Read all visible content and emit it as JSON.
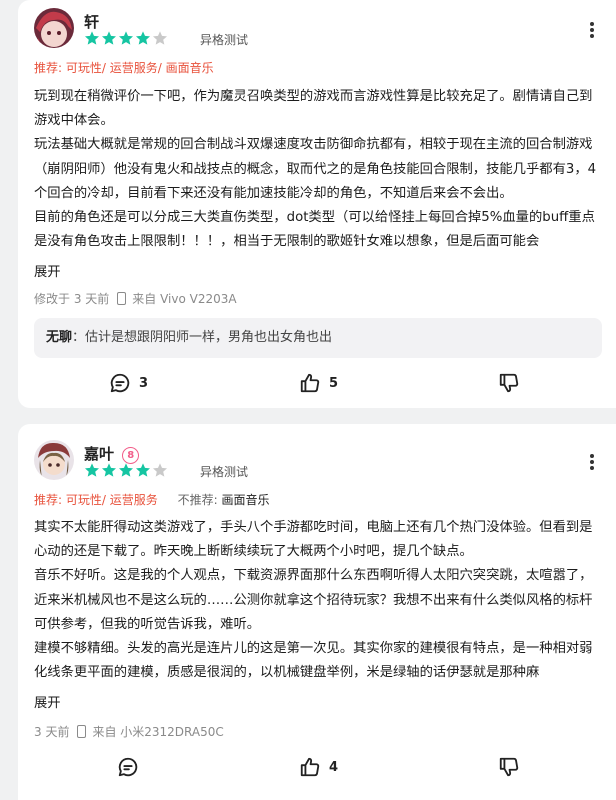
{
  "reviews": [
    {
      "user": "轩",
      "rating": 4,
      "device_label": "异格测试",
      "recommend_label": "推荐:",
      "recommend_items": "可玩性/ 运营服务/ 画面音乐",
      "paragraphs": [
        "玩到现在稍微评价一下吧，作为魔灵召唤类型的游戏而言游戏性算是比较充足了。剧情请自己到游戏中体会。",
        "玩法基础大概就是常规的回合制战斗双爆速度攻击防御命抗都有，相较于现在主流的回合制游戏（崩阴阳师）他没有鬼火和战技点的概念，取而代之的是角色技能回合限制，技能几乎都有3，4个回合的冷却，目前看下来还没有能加速技能冷却的角色，不知道后来会不会出。",
        "目前的角色还是可以分成三大类直伤类型，dot类型（可以给怪挂上每回合掉5%血量的buff重点是没有角色攻击上限限制！！！，相当于无限制的歌姬针女难以想象，但是后面可能会"
      ],
      "expand": "展开",
      "time": "修改于 3 天前",
      "device": "来自 Vivo V2203A",
      "reply_author": "无聊",
      "reply_sep": "：",
      "reply_text": "估计是想跟阴阳师一样，男角也出女角也出",
      "comments": "3",
      "likes": "5"
    },
    {
      "user": "嘉叶",
      "badge": "8",
      "rating": 4,
      "device_label": "异格测试",
      "recommend_label": "推荐:",
      "recommend_items": "可玩性/ 运营服务",
      "not_recommend_label": "不推荐:",
      "not_recommend_items": "画面音乐",
      "paragraphs": [
        "其实不太能肝得动这类游戏了，手头八个手游都吃时间，电脑上还有几个热门没体验。但看到是心动的还是下载了。昨天晚上断断续续玩了大概两个小时吧，提几个缺点。",
        "音乐不好听。这是我的个人观点，下载资源界面那什么东西啊听得人太阳穴突突跳，太喧嚣了，近来米机械风也不是这么玩的……公测你就拿这个招待玩家？我想不出来有什么类似风格的标杆可供参考，但我的听觉告诉我，难听。",
        "建模不够精细。头发的高光是连片儿的这是第一次见。其实你家的建模很有特点，是一种相对弱化线条更平面的建模，质感是很润的，以机械键盘举例，米是绿轴的话伊瑟就是那种麻"
      ],
      "expand": "展开",
      "time": "3 天前",
      "device": "来自 小米2312DRA50C",
      "comments": "",
      "likes": "4"
    }
  ],
  "colors": {
    "star_on": "#15c5a2",
    "star_off": "#c9c9c9",
    "recommend": "#e8523c",
    "badge": "#f25e8a"
  }
}
